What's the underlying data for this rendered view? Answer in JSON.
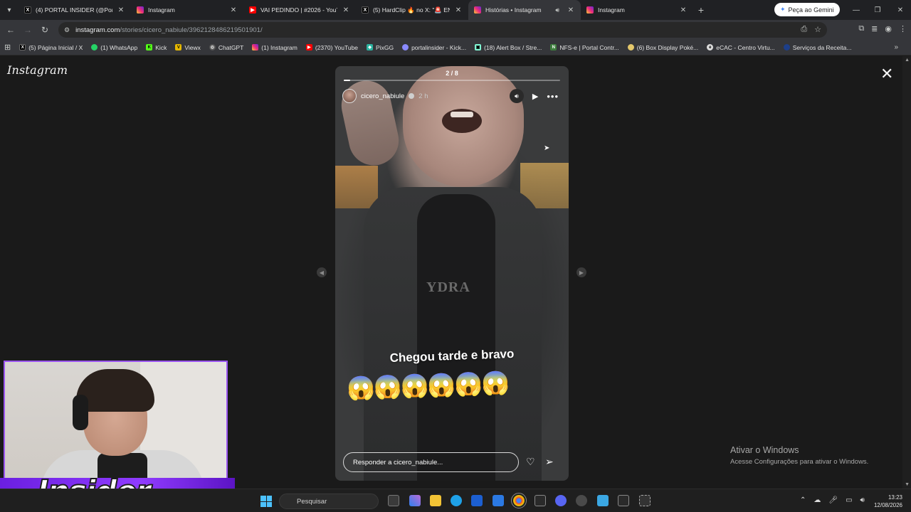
{
  "tabs": [
    {
      "label": "(4) PORTAL INSIDER (@Portal_In",
      "favicon": "x-icon",
      "active": false
    },
    {
      "label": "Instagram",
      "favicon": "instagram-icon",
      "active": false
    },
    {
      "label": "VAI PEDINDO | #2026 - YouTub",
      "favicon": "youtube-icon",
      "active": false
    },
    {
      "label": "(5) HardClip 🔥 no X: \"🚨 ENTE",
      "favicon": "x-icon",
      "active": false
    },
    {
      "label": "Histórias • Instagram",
      "favicon": "instagram-icon",
      "active": true
    },
    {
      "label": "Instagram",
      "favicon": "instagram-icon",
      "active": false
    }
  ],
  "gemini_label": "Peça ao Gemini",
  "url": {
    "host": "instagram.com",
    "path": "/stories/cicero_nabiule/3962128486219501901/"
  },
  "bookmarks": [
    {
      "label": "(5) Página Inicial / X",
      "icon": "x-icon",
      "color": "#000000"
    },
    {
      "label": "(1) WhatsApp",
      "icon": "whatsapp-icon",
      "color": "#25d366"
    },
    {
      "label": "Kick",
      "icon": "kick-icon",
      "color": "#53fc18"
    },
    {
      "label": "Viewx",
      "icon": "viewx-icon",
      "color": "#e6b800"
    },
    {
      "label": "ChatGPT",
      "icon": "chatgpt-icon",
      "color": "#555555"
    },
    {
      "label": "(1) Instagram",
      "icon": "instagram-icon",
      "color": "#d62976"
    },
    {
      "label": "(2370) YouTube",
      "icon": "youtube-icon",
      "color": "#ff0000"
    },
    {
      "label": "PixGG",
      "icon": "pixgg-icon",
      "color": "#2bb3a0"
    },
    {
      "label": "portalinsider - Kick...",
      "icon": "kick-icon",
      "color": "#8a8aff"
    },
    {
      "label": "(18) Alert Box / Stre...",
      "icon": "streamlabs-icon",
      "color": "#80f5d2"
    },
    {
      "label": "NFS-e | Portal Contr...",
      "icon": "nfse-icon",
      "color": "#3d7d3d"
    },
    {
      "label": "(6) Box Display Poké...",
      "icon": "pokemon-icon",
      "color": "#e3c76b"
    },
    {
      "label": "eCAC - Centro Virtu...",
      "icon": "ecac-icon",
      "color": "#dddddd"
    },
    {
      "label": "Serviços da Receita...",
      "icon": "receita-icon",
      "color": "#1d3f8a"
    }
  ],
  "page": {
    "logo": "Instagram",
    "story": {
      "counter": "2 / 8",
      "progress": 0.03,
      "username": "cicero_nabiule",
      "time": "2 h",
      "shirt_text": "YDRA",
      "caption": "Chegou  tarde e bravo",
      "emojis": "😱😱😱😱😱😱",
      "reply_placeholder": "Responder a cicero_nabiule..."
    },
    "activate_windows": {
      "title": "Ativar o Windows",
      "subtitle": "Acesse Configurações para ativar o Windows."
    }
  },
  "overlay": {
    "banner_text": "Insider",
    "border_color": "#9b55f0"
  },
  "taskbar": {
    "search_placeholder": "Pesquisar",
    "time": "13:23",
    "date": "12/08/2026"
  }
}
